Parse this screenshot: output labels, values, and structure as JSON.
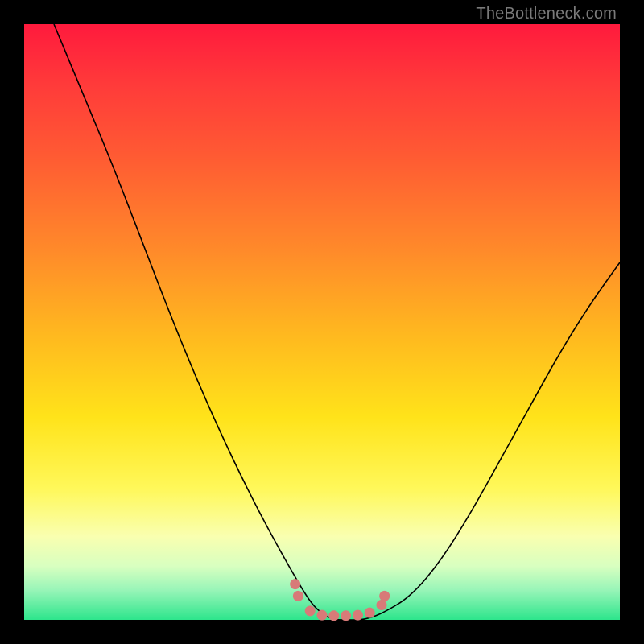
{
  "watermark": "TheBottleneck.com",
  "chart_data": {
    "type": "line",
    "title": "",
    "xlabel": "",
    "ylabel": "",
    "xlim": [
      0,
      100
    ],
    "ylim": [
      0,
      100
    ],
    "note": "V-shaped bottleneck curve over a red-to-green gradient. Y values are bottleneck percentage (high=red, low=green). X is relative hardware balance. Pink markers cluster at the optimal (minimum-bottleneck) region.",
    "series": [
      {
        "name": "bottleneck-curve",
        "x": [
          5,
          10,
          15,
          20,
          25,
          30,
          35,
          40,
          45,
          48,
          50,
          52,
          55,
          57,
          60,
          65,
          70,
          75,
          80,
          85,
          90,
          95,
          100
        ],
        "values": [
          100,
          88,
          76,
          63,
          50,
          38,
          27,
          17,
          8,
          3,
          1,
          0,
          0,
          0,
          1,
          4,
          10,
          18,
          27,
          36,
          45,
          53,
          60
        ]
      }
    ],
    "markers": [
      {
        "x": 45.5,
        "y": 6
      },
      {
        "x": 46,
        "y": 4
      },
      {
        "x": 48,
        "y": 1.5
      },
      {
        "x": 50,
        "y": 0.8
      },
      {
        "x": 52,
        "y": 0.7
      },
      {
        "x": 54,
        "y": 0.7
      },
      {
        "x": 56,
        "y": 0.8
      },
      {
        "x": 58,
        "y": 1.2
      },
      {
        "x": 60,
        "y": 2.5
      },
      {
        "x": 60.5,
        "y": 4
      }
    ],
    "gradient_stops": [
      {
        "pct": 0,
        "color": "#ff1a3d"
      },
      {
        "pct": 50,
        "color": "#ffb81f"
      },
      {
        "pct": 80,
        "color": "#fff85a"
      },
      {
        "pct": 100,
        "color": "#2de58c"
      }
    ]
  }
}
